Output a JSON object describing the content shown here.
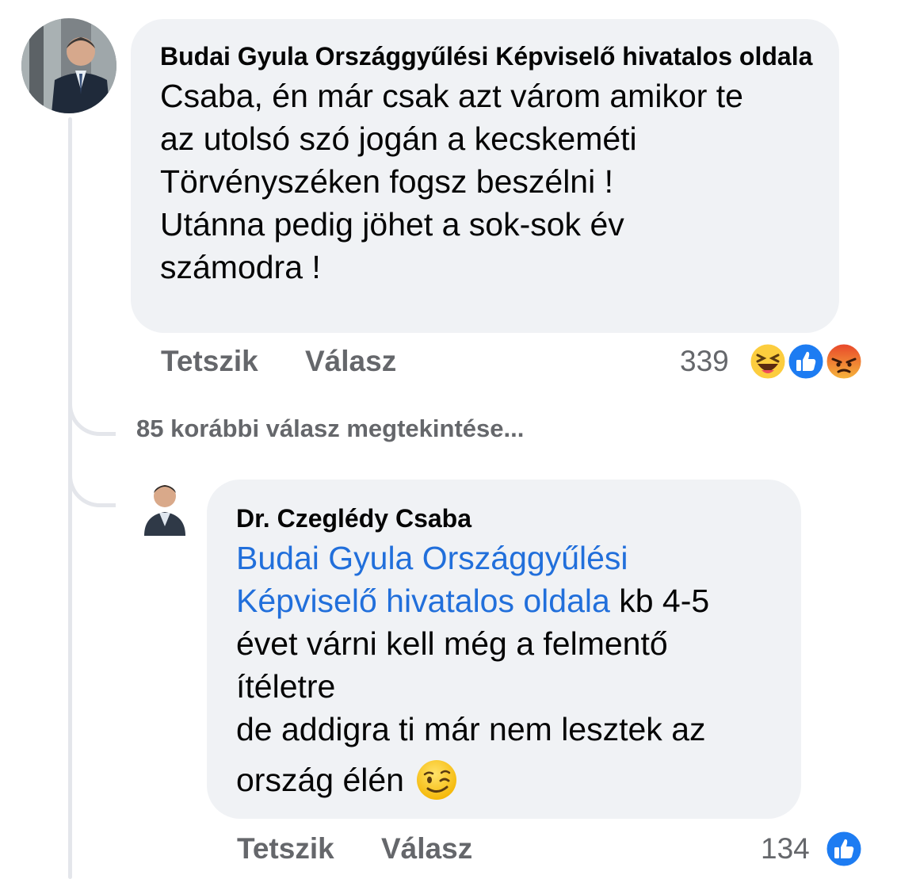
{
  "comments": [
    {
      "author": "Budai Gyula Országgyűlési Képviselő hivatalos oldala",
      "lines": [
        "Csaba, én már csak azt várom amikor te",
        "az utolsó szó jogán a kecskeméti",
        "Törvényszéken fogsz beszélni !",
        "Utánna pedig jöhet a sok-sok év",
        "számodra !"
      ],
      "like_label": "Tetszik",
      "reply_label": "Válasz",
      "reaction_count": "339",
      "reactions": [
        "laughing-emoji",
        "like-icon",
        "angry-emoji"
      ]
    },
    {
      "author": "Dr. Czeglédy Csaba",
      "mention_line1": "Budai Gyula Országgyűlési",
      "mention_line2": "Képviselő hivatalos oldala",
      "after_mention": " kb 4-5",
      "lines": [
        "évet várni kell még a felmentő",
        "ítéletre",
        "de addigra ti már nem lesztek az"
      ],
      "last_line": "ország élén",
      "last_emoji": "winking-face-emoji",
      "like_label": "Tetszik",
      "reply_label": "Válasz",
      "reaction_count": "134",
      "reactions": [
        "like-icon"
      ]
    }
  ],
  "view_more_replies": "85 korábbi válasz megtekintése..."
}
